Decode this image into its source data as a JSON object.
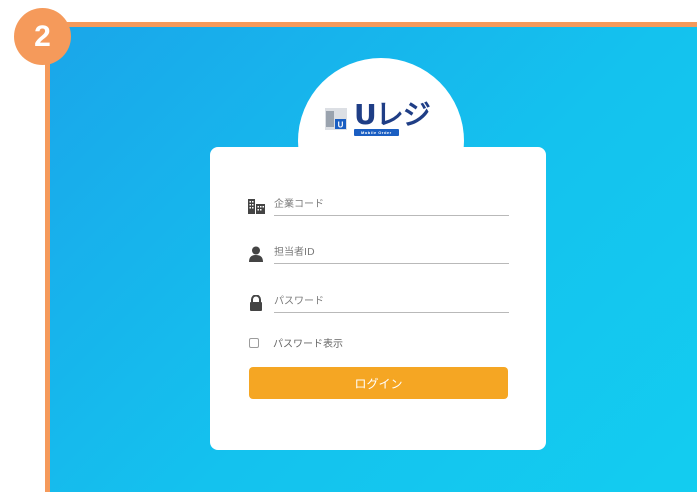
{
  "step_badge": "2",
  "logo": {
    "text": "Uレジ",
    "subtitle": "Mobile Order"
  },
  "form": {
    "company_code_placeholder": "企業コード",
    "staff_id_placeholder": "担当者ID",
    "password_placeholder": "パスワード",
    "show_password_label": "パスワード表示",
    "show_password_checked": false,
    "login_button_label": "ログイン"
  },
  "icons": {
    "company": "building-icon",
    "staff": "person-icon",
    "password": "lock-icon"
  },
  "colors": {
    "badge": "#f59a5b",
    "frame_border": "#f59a5b",
    "background_start": "#1aa6ea",
    "background_end": "#13cdf0",
    "login_button": "#f5a623",
    "logo_text": "#1f3e86"
  }
}
